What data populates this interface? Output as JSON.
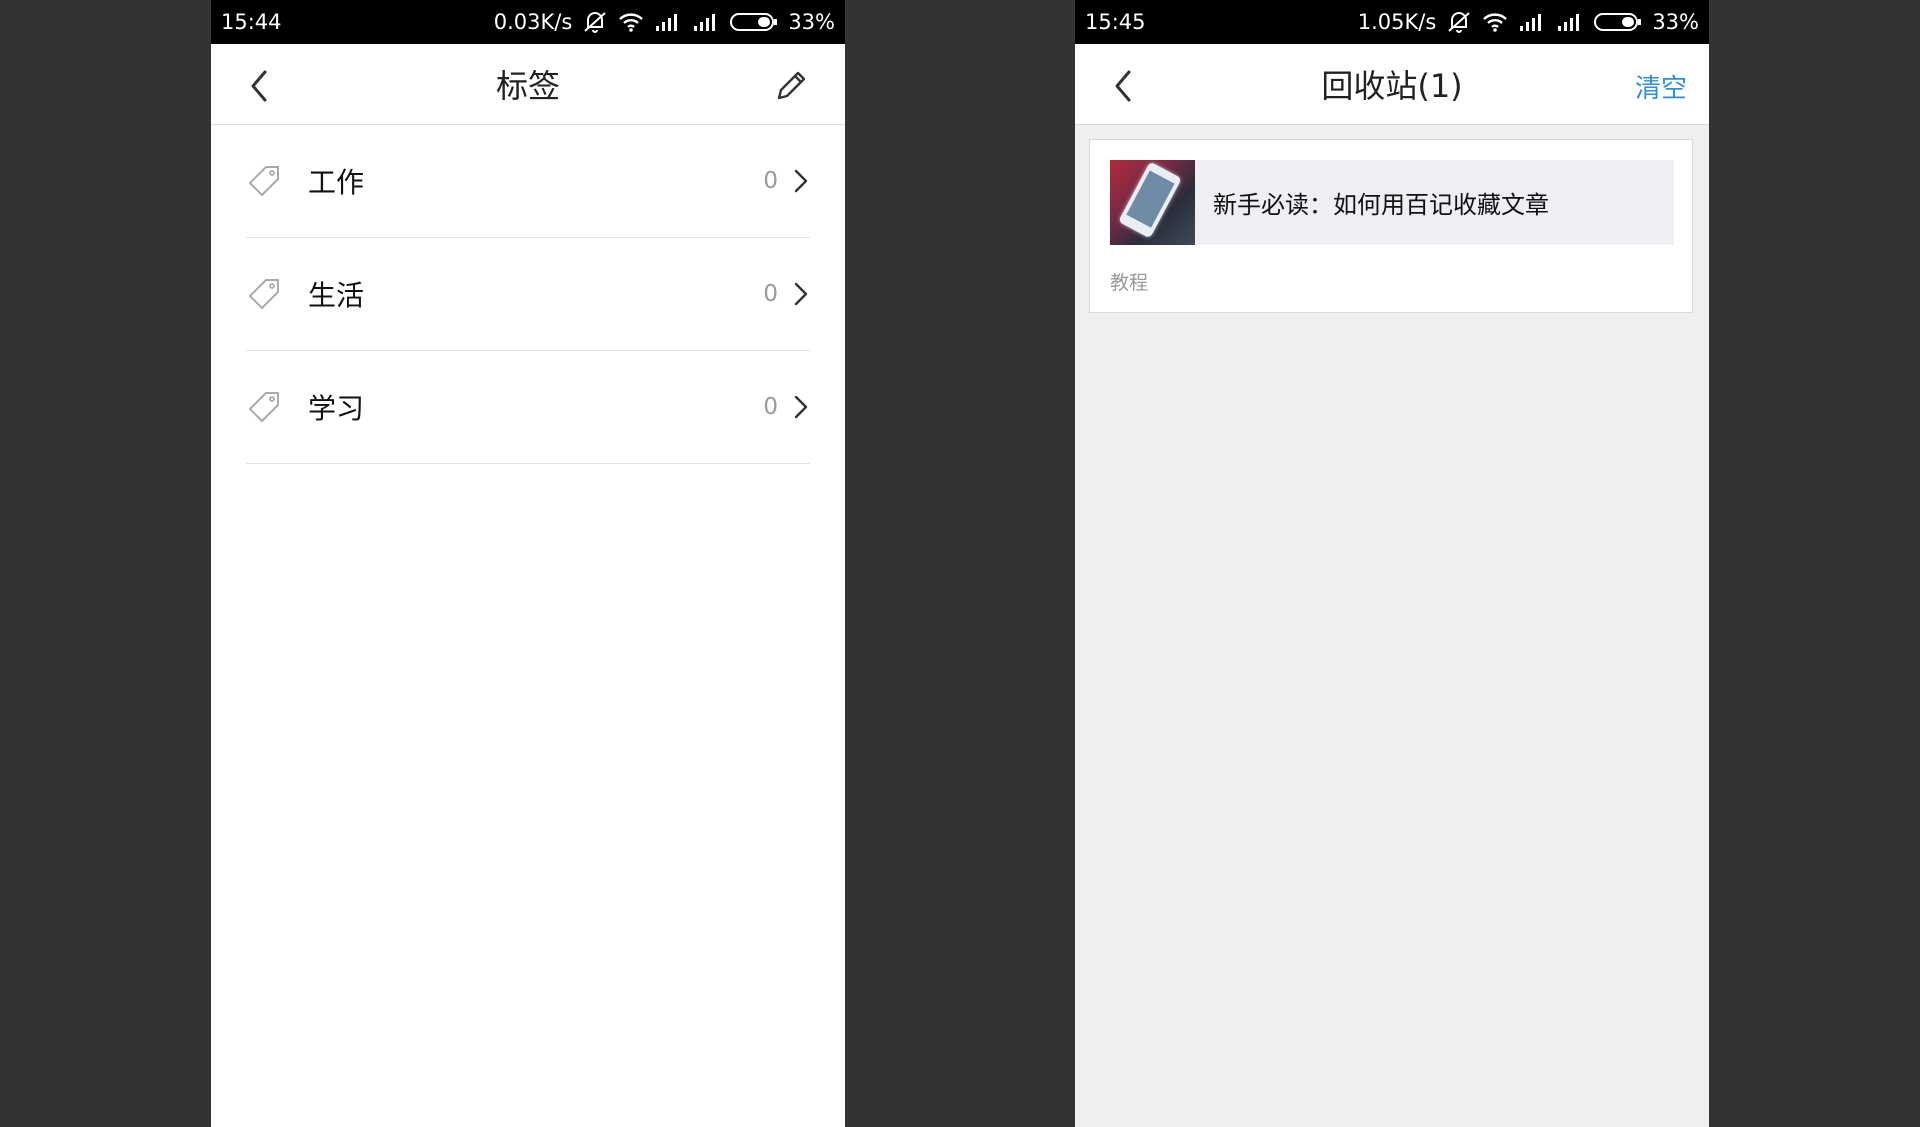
{
  "left_screen": {
    "status": {
      "time": "15:44",
      "speed": "0.03K/s",
      "battery": "33%"
    },
    "title": "标签",
    "tags": [
      {
        "label": "工作",
        "count": "0"
      },
      {
        "label": "生活",
        "count": "0"
      },
      {
        "label": "学习",
        "count": "0"
      }
    ]
  },
  "right_screen": {
    "status": {
      "time": "15:45",
      "speed": "1.05K/s",
      "battery": "33%"
    },
    "title": "回收站(1)",
    "clear_label": "清空",
    "items": [
      {
        "title": "新手必读：如何用百记收藏文章",
        "tag": "教程"
      }
    ]
  },
  "colors": {
    "accent": "#2f8fd8",
    "background": "#333333",
    "trash_background": "#efeef0"
  }
}
